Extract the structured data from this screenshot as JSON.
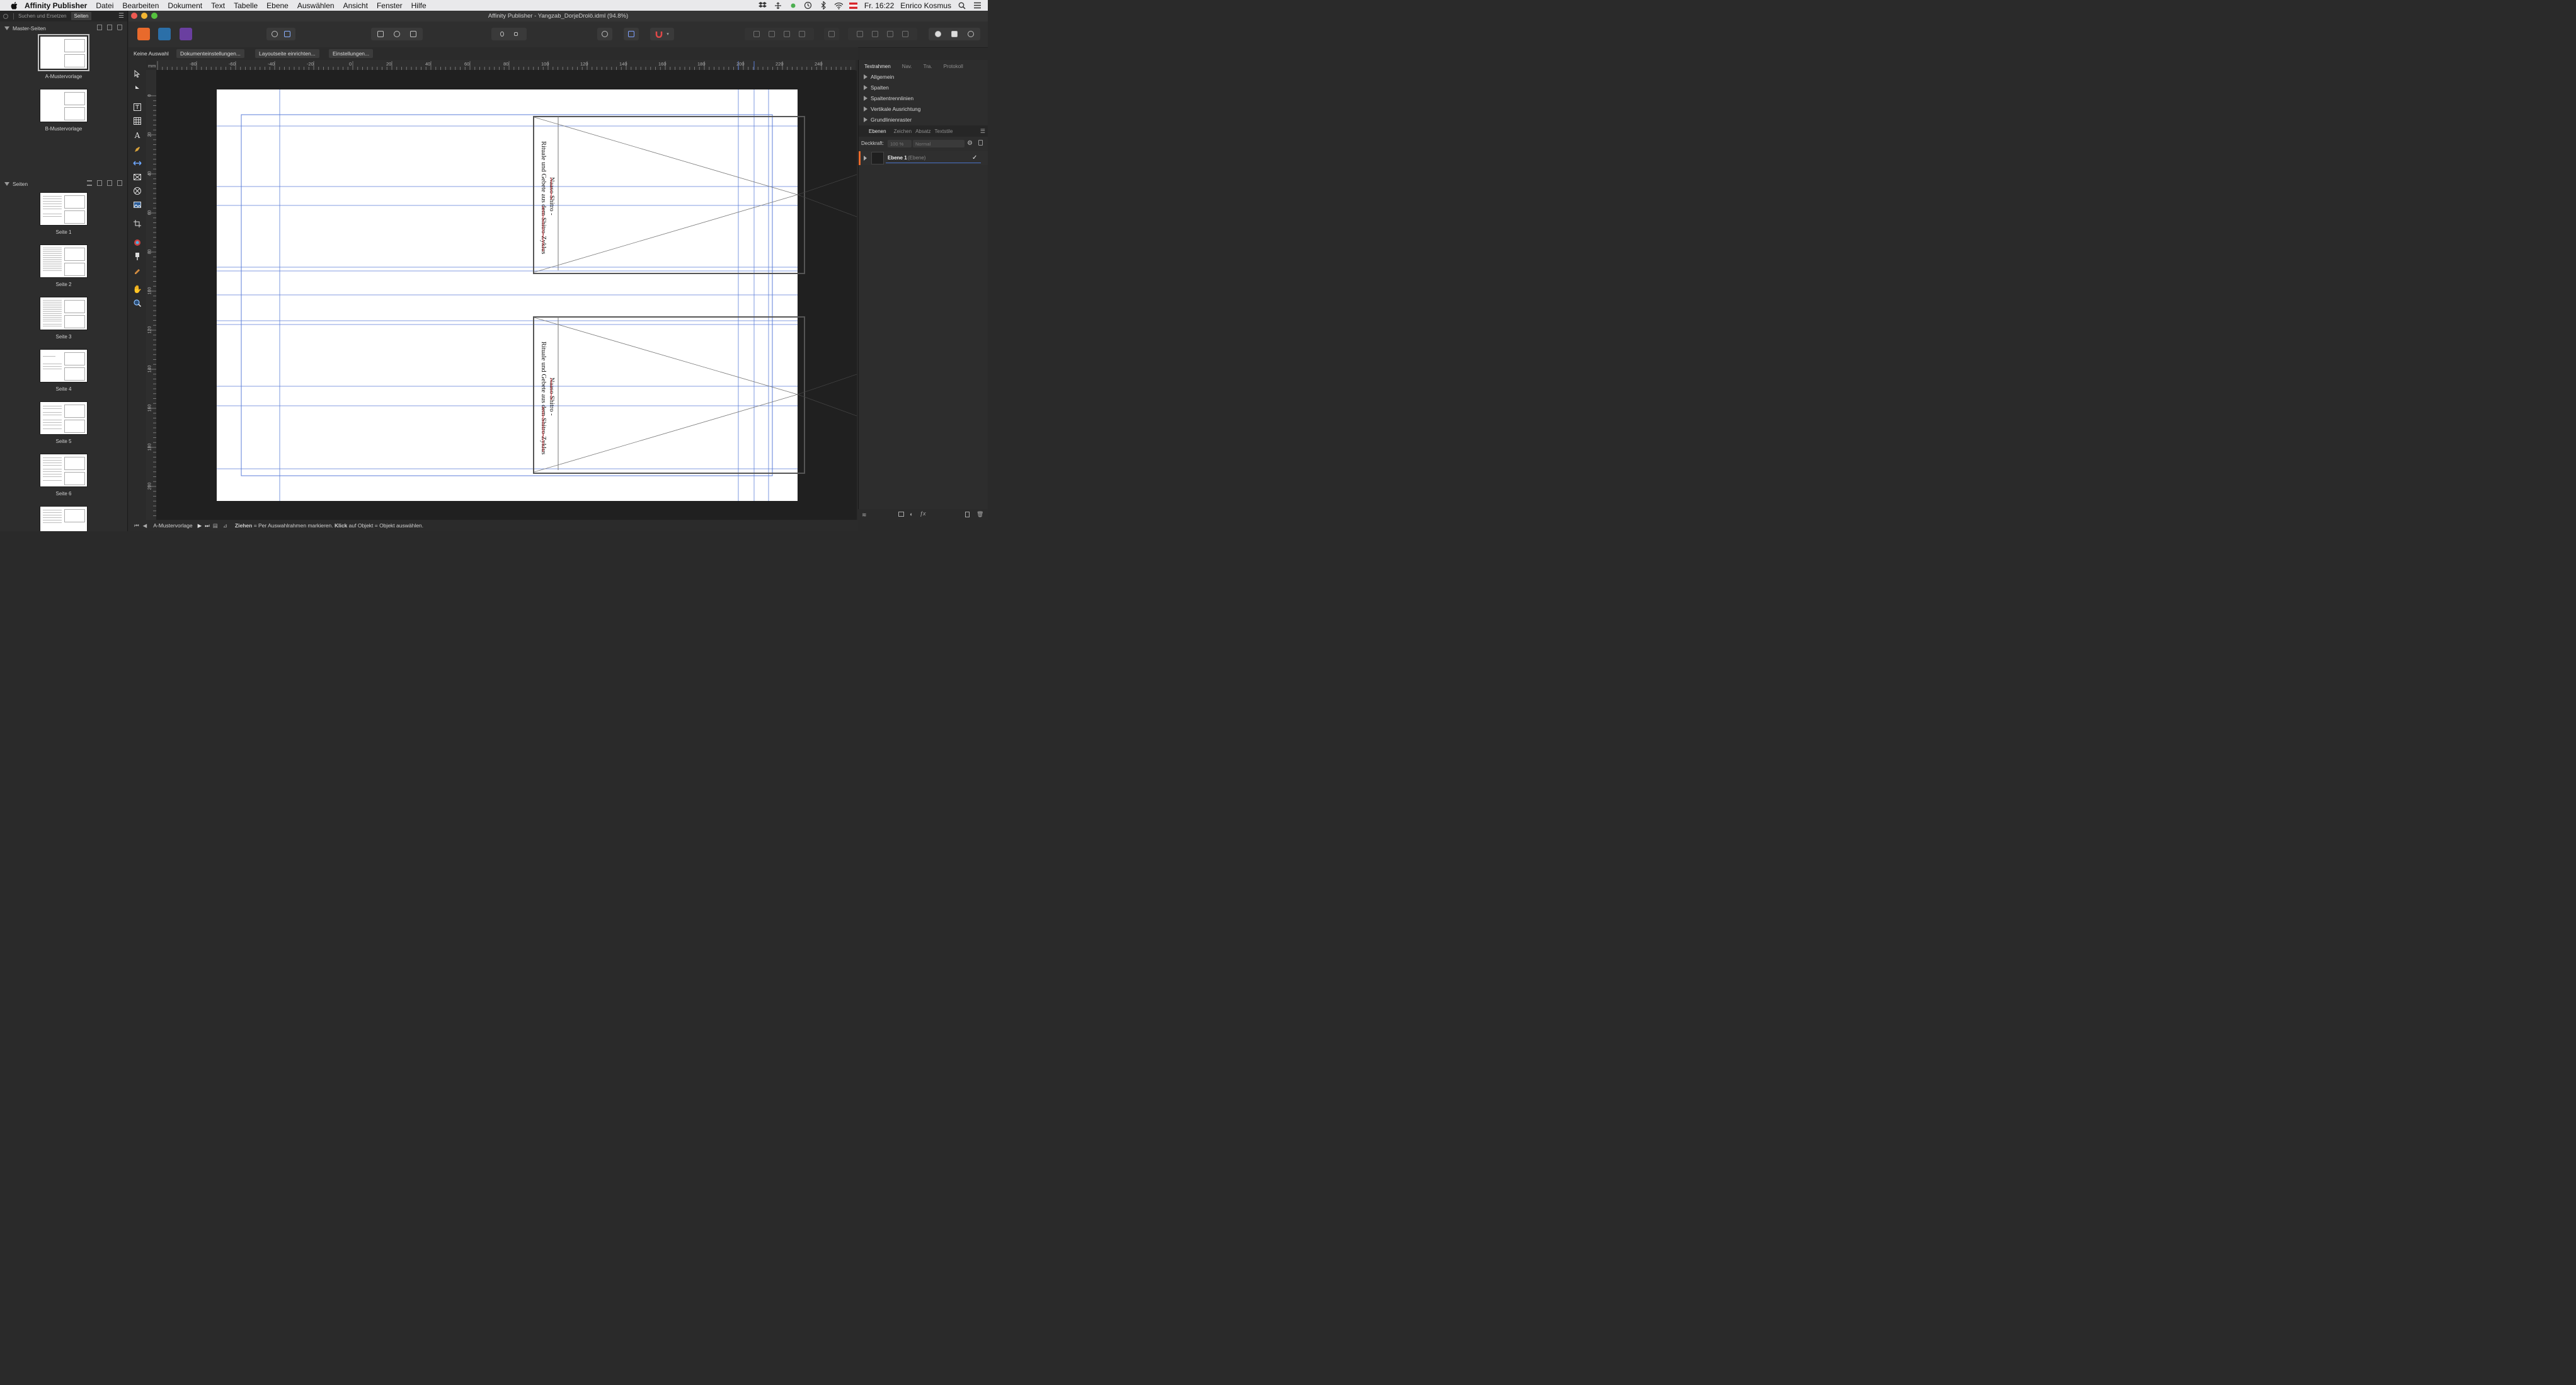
{
  "menubar": {
    "app": "Affinity Publisher",
    "items": [
      "Datei",
      "Bearbeiten",
      "Dokument",
      "Text",
      "Tabelle",
      "Ebene",
      "Auswählen",
      "Ansicht",
      "Fenster",
      "Hilfe"
    ],
    "clock": "Fr. 16:22",
    "user": "Enrico Kosmus"
  },
  "window": {
    "title": "Affinity Publisher - Yangzab_DorjeDrolö.idml (94.8%)"
  },
  "left_panel": {
    "tabs": [
      "Suchen und Ersetzen",
      "Seiten"
    ],
    "active_tab": "Seiten",
    "masters_heading": "Master-Seiten",
    "masters": [
      "A-Mustervorlage",
      "B-Mustervorlage"
    ],
    "pages_heading": "Seiten",
    "pages": [
      "Seite 1",
      "Seite 2",
      "Seite 3",
      "Seite 4",
      "Seite 5",
      "Seite 6"
    ]
  },
  "context_bar": {
    "selection": "Keine Auswahl",
    "buttons": [
      "Dokumenteinstellungen...",
      "Layoutseite einrichten...",
      "Einstellungen..."
    ]
  },
  "ruler": {
    "unit": "mm",
    "h_labels": [
      "-80",
      "-60",
      "-40",
      "-20",
      "0",
      "20",
      "40",
      "60",
      "80",
      "100",
      "120",
      "140",
      "160",
      "180",
      "200",
      "220",
      "240"
    ],
    "v_labels": [
      "0",
      "20",
      "40",
      "60",
      "80",
      "100",
      "120",
      "140",
      "160",
      "180",
      "200"
    ]
  },
  "document": {
    "spine_title": "Naaso Shitro -",
    "spine_subtitle": "Rituale und Gebete aus dem Shitro-Zyklus"
  },
  "right_panel": {
    "top_tabs": [
      "Textrahmen",
      "Nav.",
      "Tra.",
      "Protokoll"
    ],
    "active_top_tab": "Textrahmen",
    "sections": [
      "Allgemein",
      "Spalten",
      "Spaltentrennlinien",
      "Vertikale Ausrichtung",
      "Grundlinienraster"
    ],
    "layer_tabs": [
      "Ebenen",
      "Zeichen",
      "Absatz",
      "Textstile"
    ],
    "active_layer_tab": "Ebenen",
    "opacity_label": "Deckkraft:",
    "opacity_value": "100 %",
    "blend_mode": "Normal",
    "layer_name": "Ebene 1",
    "layer_type": "(Ebene)"
  },
  "status_bar": {
    "page": "A-Mustervorlage",
    "hint_bold1": "Ziehen",
    "hint_text1": " = Per Auswahlrahmen markieren. ",
    "hint_bold2": "Klick",
    "hint_text2": " auf Objekt = Objekt auswählen."
  },
  "colors": {
    "accent": "#e86a2c",
    "guide": "#5b7ed8",
    "spellcheck": "#d0242b"
  }
}
